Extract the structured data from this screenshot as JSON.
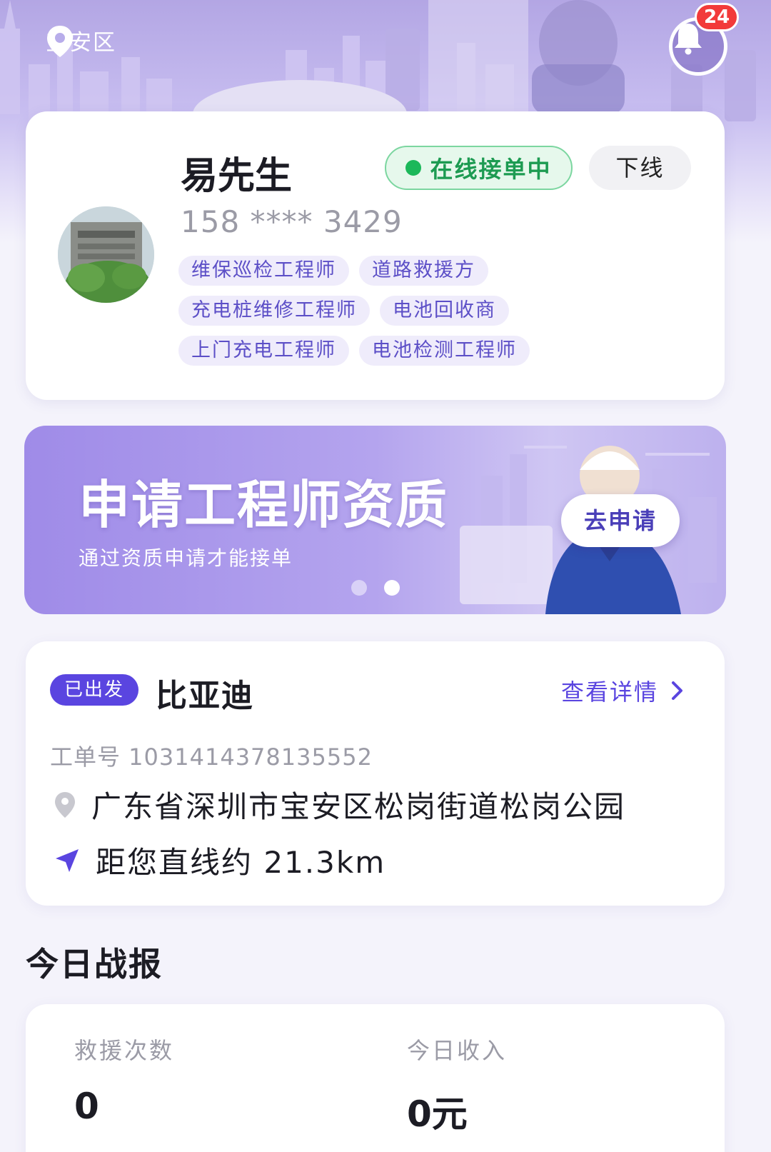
{
  "header": {
    "location": "宝安区",
    "notification_count": "24"
  },
  "profile": {
    "name": "易先生",
    "status": "在线接单中",
    "offline_label": "下线",
    "phone": "158 **** 3429",
    "tags": [
      "维保巡检工程师",
      "道路救援方",
      "充电桩维修工程师",
      "电池回收商",
      "上门充电工程师",
      "电池检测工程师"
    ]
  },
  "banner": {
    "title": "申请工程师资质",
    "subtitle": "通过资质申请才能接单",
    "button": "去申请",
    "page_count": 2,
    "active_page": 2
  },
  "order": {
    "status": "已出发",
    "brand": "比亚迪",
    "detail_link": "查看详情",
    "order_number": "工单号 1031414378135552",
    "address": "广东省深圳市宝安区松岗街道松岗公园",
    "distance": "距您直线约 21.3km"
  },
  "today": {
    "title": "今日战报",
    "stats": [
      {
        "label": "救援次数",
        "value": "0"
      },
      {
        "label": "今日收入",
        "value": "0元"
      }
    ]
  },
  "colors": {
    "accent": "#5a45e0",
    "online_green": "#1cb85a",
    "badge_red": "#f23a3a",
    "tag_bg": "#efecfb"
  }
}
